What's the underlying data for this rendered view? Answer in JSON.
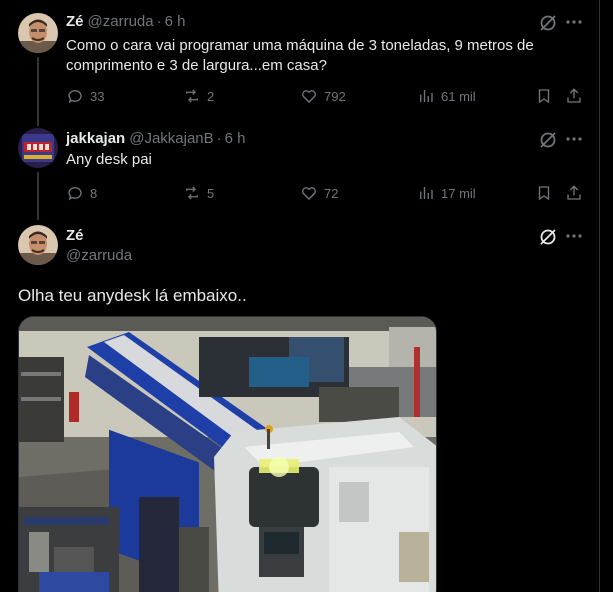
{
  "tweets": [
    {
      "name": "Zé",
      "handle": "@zarruda",
      "separator": "·",
      "time": "6 h",
      "text": "Como o cara vai programar uma máquina de 3 toneladas, 9 metros de comprimento e 3 de largura...em casa?",
      "replies": "33",
      "reposts": "2",
      "likes": "792",
      "views": "61 mil"
    },
    {
      "name": "jakkajan",
      "handle": "@JakkajanB",
      "separator": "·",
      "time": "6 h",
      "text": "Any desk pai",
      "replies": "8",
      "reposts": "5",
      "likes": "72",
      "views": "17 mil"
    }
  ],
  "main_tweet": {
    "name": "Zé",
    "handle": "@zarruda",
    "text": "Olha teu anydesk lá embaixo.."
  },
  "colors": {
    "background": "#000000",
    "text": "#e7e9ea",
    "muted": "#71767b",
    "divider": "#2f3336"
  },
  "icons": [
    "grok-icon",
    "more-icon",
    "reply-icon",
    "repost-icon",
    "like-icon",
    "views-icon",
    "bookmark-icon",
    "share-icon"
  ]
}
